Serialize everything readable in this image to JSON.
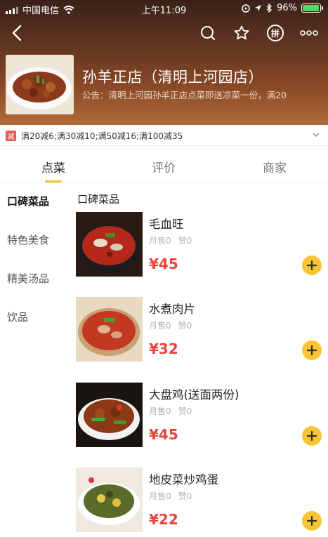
{
  "status_bar": {
    "carrier": "中国电信",
    "time": "上午11:09",
    "battery": "96%",
    "battery_level": 0.96
  },
  "nav": {
    "pin_label": "拼",
    "icons": [
      "back-icon",
      "search-icon",
      "star-icon",
      "group-buy-icon",
      "more-icon"
    ]
  },
  "shop": {
    "name": "孙羊正店（清明上河园店）",
    "notice": "公告：清明上河园孙羊正店点菜即送凉菜一份，满20"
  },
  "promo": {
    "tag": "减",
    "text": "满20减6;满30减10;满50减16;满100减35"
  },
  "tabs": [
    {
      "label": "点菜"
    },
    {
      "label": "评价"
    },
    {
      "label": "商家"
    }
  ],
  "sidebar": {
    "items": [
      {
        "label": "口碑菜品"
      },
      {
        "label": "特色美食"
      },
      {
        "label": "精美汤品"
      },
      {
        "label": "饮品"
      }
    ]
  },
  "content": {
    "section_title": "口碑菜品",
    "dishes": [
      {
        "name": "毛血旺",
        "sales": "月售0",
        "likes": "赞0",
        "price": "¥45"
      },
      {
        "name": "水煮肉片",
        "sales": "月售0",
        "likes": "赞0",
        "price": "¥32"
      },
      {
        "name": "大盘鸡(送面两份)",
        "sales": "月售0",
        "likes": "赞0",
        "price": "¥45"
      },
      {
        "name": "地皮菜炒鸡蛋",
        "sales": "月售0",
        "likes": "赞0",
        "price": "¥22"
      }
    ]
  },
  "colors": {
    "accent": "#f9c534",
    "price": "#e8453c",
    "promo_tag": "#e85a4f"
  }
}
